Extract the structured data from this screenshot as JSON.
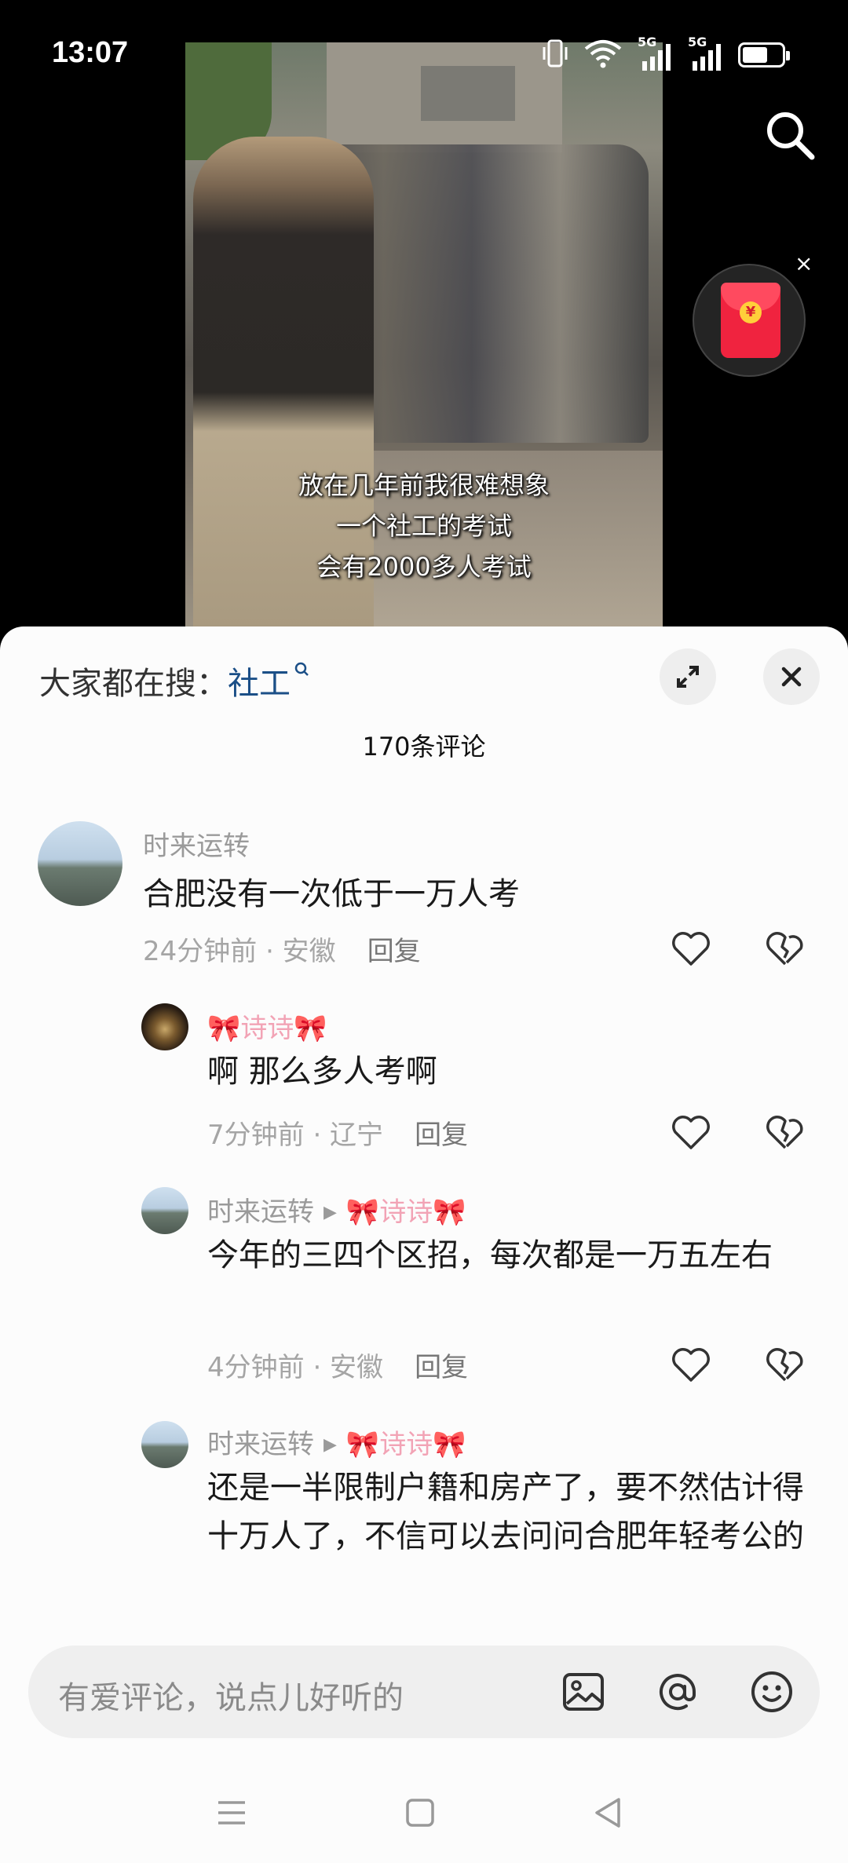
{
  "status_bar": {
    "time": "13:07",
    "network_1": "5G",
    "network_2": "5G",
    "battery_level": 0.65
  },
  "video": {
    "subtitle_lines": [
      "放在几年前我很难想象",
      "一个社工的考试",
      "会有2000多人考试"
    ]
  },
  "overlay": {
    "search_icon": "search-icon",
    "red_packet_icon": "red-packet-icon",
    "red_packet_symbol": "¥",
    "close_symbol": "×"
  },
  "comment_sheet": {
    "trending_label": "大家都在搜：",
    "trending_term": "社工",
    "comment_count": "170条评论",
    "comments": [
      {
        "user": "时来运转",
        "text": "合肥没有一次低于一万人考",
        "time_location": "24分钟前 · 安徽",
        "reply_label": "回复"
      },
      {
        "user": "🎀诗诗🎀",
        "text": "啊 那么多人考啊",
        "time_location": "7分钟前 · 辽宁",
        "reply_label": "回复"
      },
      {
        "user": "时来运转",
        "reply_to": "🎀诗诗🎀",
        "text": "今年的三四个区招，每次都是一万五左右",
        "time_location": "4分钟前 · 安徽",
        "reply_label": "回复"
      },
      {
        "user": "时来运转",
        "reply_to": "🎀诗诗🎀",
        "text": "还是一半限制户籍和房产了，要不然估计得十万人了，不信可以去问问合肥年轻考公的"
      }
    ],
    "input_placeholder": "有爱评论，说点儿好听的"
  },
  "colors": {
    "accent_link": "#1b4f87",
    "sheet_bg": "#fcfcfc",
    "red_packet": "#f0233f"
  }
}
